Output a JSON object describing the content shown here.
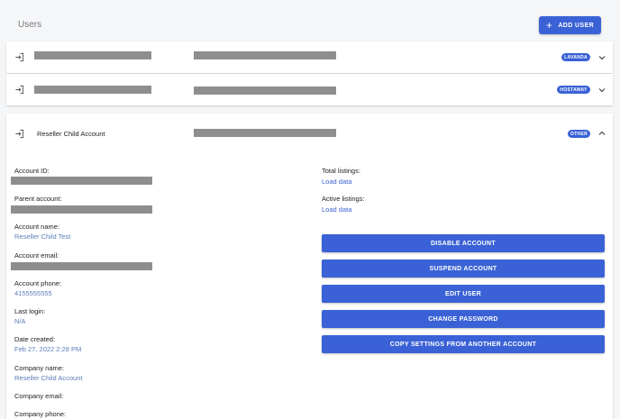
{
  "header": {
    "title": "Users",
    "add_user_label": "ADD USER"
  },
  "users": [
    {
      "badge": "LAVANDA"
    },
    {
      "badge": "HOSTAWAY"
    },
    {
      "name": "Reseller Child Account",
      "badge": "OTHER"
    }
  ],
  "details": {
    "account_id_label": "Account ID:",
    "parent_account_label": "Parent account:",
    "account_name_label": "Account name:",
    "account_name_value": "Reseller Child Test",
    "account_email_label": "Account email:",
    "account_phone_label": "Account phone:",
    "account_phone_value": "4155555555",
    "last_login_label": "Last login:",
    "last_login_value": "N/A",
    "date_created_label": "Date created:",
    "date_created_value": "Feb 27, 2022 2:28 PM",
    "company_name_label": "Company name:",
    "company_name_value": "Reseller Child Account",
    "company_email_label": "Company email:",
    "company_phone_label": "Company phone:",
    "total_listings_label": "Total listings:",
    "active_listings_label": "Active listings:",
    "load_data_label": "Load data"
  },
  "actions": {
    "disable": "DISABLE ACCOUNT",
    "suspend": "SUSPEND ACCOUNT",
    "edit": "EDIT USER",
    "change_password": "CHANGE PASSWORD",
    "copy_settings": "COPY SETTINGS FROM ANOTHER ACCOUNT"
  },
  "colors": {
    "accent": "#3a62d6",
    "value_text": "#5b7db8",
    "redaction": "#8e8e8e"
  },
  "icons": {
    "login": "login-icon",
    "chevron_down": "chevron-down-icon",
    "chevron_up": "chevron-up-icon",
    "plus": "plus-icon"
  }
}
